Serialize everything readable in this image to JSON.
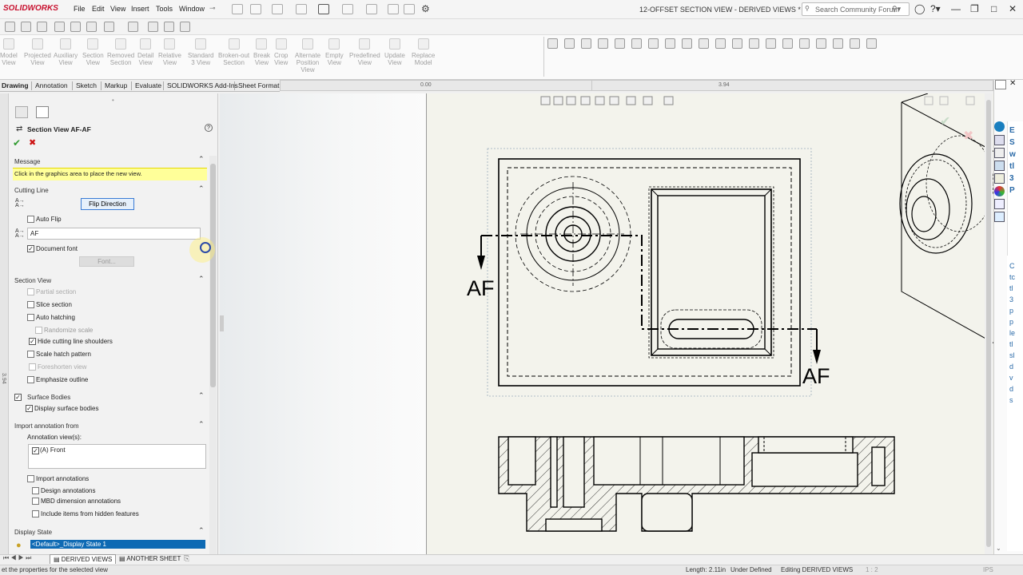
{
  "app": {
    "logo": "SOLIDWORKS",
    "title": "12-OFFSET SECTION VIEW - DERIVED VIEWS *"
  },
  "menu": [
    "File",
    "Edit",
    "View",
    "Insert",
    "Tools",
    "Window"
  ],
  "search": {
    "placeholder": "Search Community Forum"
  },
  "ribbon": [
    {
      "label": "Model\nView"
    },
    {
      "label": "Projected\nView"
    },
    {
      "label": "Auxiliary\nView"
    },
    {
      "label": "Section\nView"
    },
    {
      "label": "Removed\nSection"
    },
    {
      "label": "Detail\nView"
    },
    {
      "label": "Relative\nView"
    },
    {
      "label": "Standard\n3 View"
    },
    {
      "label": "Broken-out\nSection"
    },
    {
      "label": "Break\nView"
    },
    {
      "label": "Crop\nView"
    },
    {
      "label": "Alternate\nPosition\nView"
    },
    {
      "label": "Empty\nView"
    },
    {
      "label": "Predefined\nView"
    },
    {
      "label": "Update\nView"
    },
    {
      "label": "Replace\nModel"
    }
  ],
  "tabs": [
    "Drawing",
    "Annotation",
    "Sketch",
    "Markup",
    "Evaluate",
    "SOLIDWORKS Add-Ins",
    "Sheet Format"
  ],
  "ruler": {
    "left": "0.00",
    "right": "3.94"
  },
  "panel": {
    "title": "Section View AF-AF",
    "message_header": "Message",
    "message": "Click in the graphics area to place the new view.",
    "cutting_line_header": "Cutting Line",
    "flip_direction": "Flip Direction",
    "auto_flip": "Auto Flip",
    "label_value": "AF",
    "document_font": "Document font",
    "font_button": "Font...",
    "section_view_header": "Section View",
    "partial_section": "Partial section",
    "slice_section": "Slice section",
    "auto_hatching": "Auto hatching",
    "randomize_scale": "Randomize scale",
    "hide_shoulders": "Hide cutting line shoulders",
    "scale_hatch": "Scale hatch pattern",
    "foreshorten": "Foreshorten view",
    "emphasize": "Emphasize outline",
    "surface_bodies_header": "Surface Bodies",
    "display_surface": "Display surface bodies",
    "import_header": "Import annotation from",
    "annotation_views": "Annotation view(s):",
    "front_item": "(A) Front",
    "import_annotations": "Import annotations",
    "design_annotations": "Design annotations",
    "mbd_annotations": "MBD dimension annotations",
    "hidden_features": "Include items from hidden features",
    "display_state_header": "Display State",
    "display_state_value": "<Default>_Display State 1"
  },
  "drawing": {
    "label_left": "AF",
    "label_right": "AF"
  },
  "sheets": [
    "DERIVED VIEWS",
    "ANOTHER SHEET"
  ],
  "status": {
    "left": "et the properties for the selected view",
    "length": "Length: 2.11in",
    "defined": "Under Defined",
    "editing": "Editing DERIVED VIEWS",
    "scale": "1 : 2",
    "units": "IPS"
  },
  "vertical_ruler": "3.94",
  "taskpane_text": [
    "E",
    "S",
    "w",
    "tl",
    "3",
    "P",
    "C",
    "tc",
    "tl",
    "3",
    "p",
    "p",
    "le",
    "tl",
    "sl",
    "d",
    "v",
    "d",
    "s"
  ]
}
